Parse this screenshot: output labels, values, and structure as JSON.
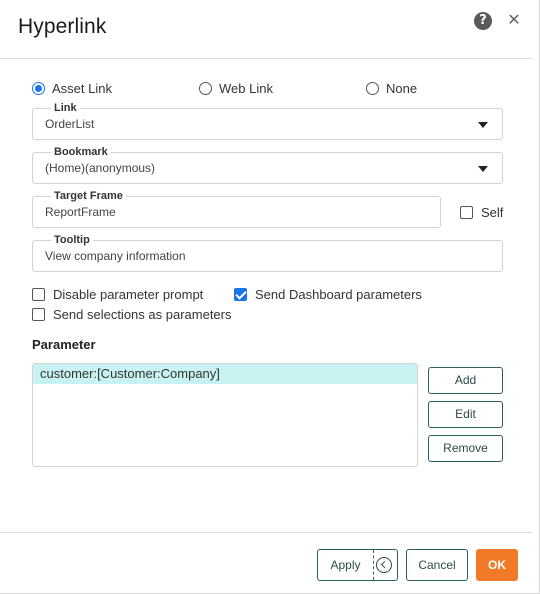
{
  "dialog": {
    "title": "Hyperlink"
  },
  "link_type": {
    "options": [
      {
        "label": "Asset Link",
        "selected": true
      },
      {
        "label": "Web Link",
        "selected": false
      },
      {
        "label": "None",
        "selected": false
      }
    ]
  },
  "fields": {
    "link": {
      "label": "Link",
      "value": "OrderList"
    },
    "bookmark": {
      "label": "Bookmark",
      "value": "(Home)(anonymous)"
    },
    "target_frame": {
      "label": "Target Frame",
      "value": "ReportFrame"
    },
    "tooltip": {
      "label": "Tooltip",
      "value": "View company information"
    }
  },
  "options": {
    "self": {
      "label": "Self",
      "checked": false
    },
    "disable_param_prompt": {
      "label": "Disable parameter prompt",
      "checked": false
    },
    "send_dashboard_params": {
      "label": "Send Dashboard parameters",
      "checked": true
    },
    "send_selections": {
      "label": "Send selections as parameters",
      "checked": false
    }
  },
  "parameter": {
    "heading": "Parameter",
    "items": [
      "customer:[Customer:Company]"
    ],
    "add_label": "Add",
    "edit_label": "Edit",
    "remove_label": "Remove"
  },
  "footer": {
    "apply_label": "Apply",
    "cancel_label": "Cancel",
    "ok_label": "OK"
  },
  "icons": {
    "help": "help-icon",
    "close": "close-icon",
    "dropdown": "caret-down-icon",
    "apply_menu": "chevron-left-circle-icon"
  },
  "colors": {
    "accent": "#1a73e8",
    "selected_row": "#c9f3f3",
    "ok_button": "#f07a28",
    "button_border": "#2e5f5f"
  }
}
